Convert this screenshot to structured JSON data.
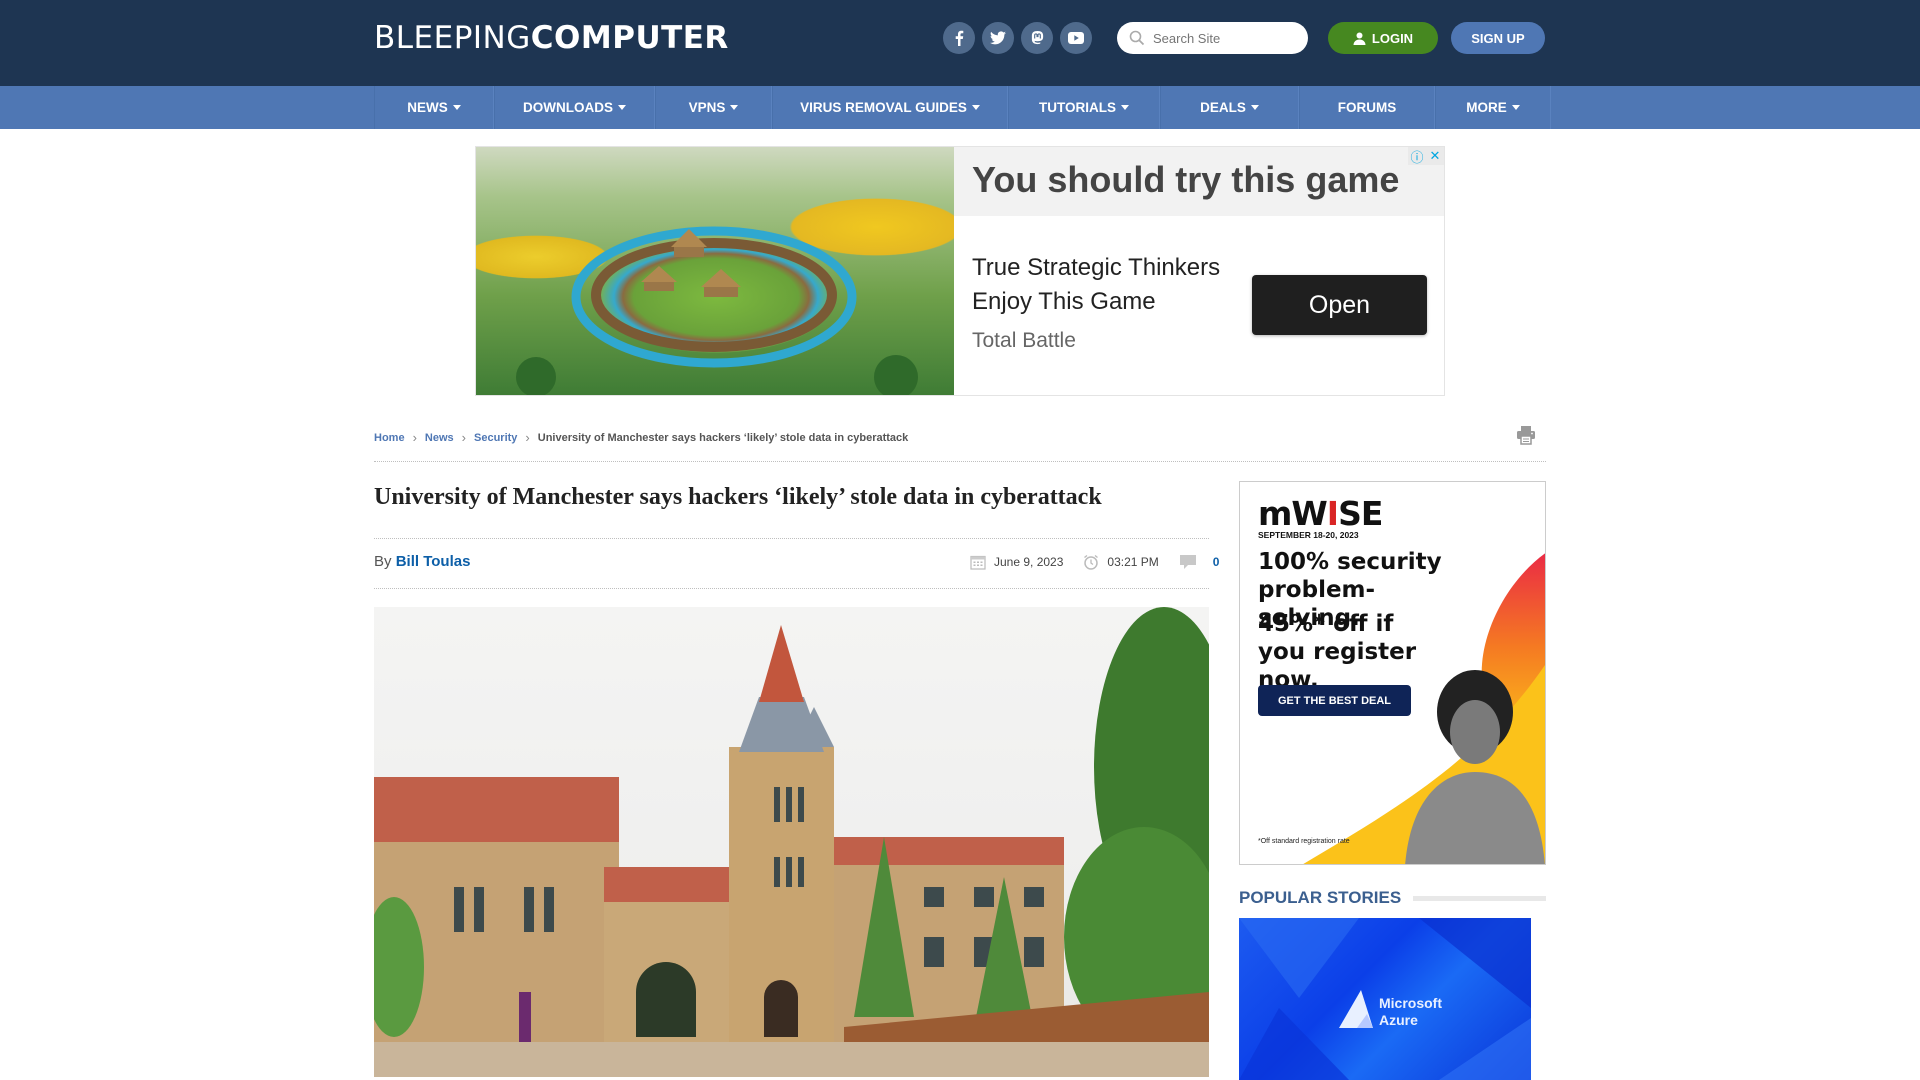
{
  "site": {
    "logo_light": "BLEEPING",
    "logo_bold": "COMPUTER"
  },
  "header": {
    "social": [
      {
        "name": "facebook",
        "icon": "facebook-icon"
      },
      {
        "name": "twitter",
        "icon": "twitter-icon"
      },
      {
        "name": "mastodon",
        "icon": "mastodon-icon"
      },
      {
        "name": "youtube",
        "icon": "youtube-icon"
      }
    ],
    "search_placeholder": "Search Site",
    "search_value": "",
    "login_label": "LOGIN",
    "signup_label": "SIGN UP",
    "colors": {
      "topbar": "#1e3552",
      "navbar": "#4f77b4",
      "login": "#468820",
      "signup": "#4f77b4"
    }
  },
  "nav": {
    "items": [
      {
        "label": "NEWS",
        "dropdown": true
      },
      {
        "label": "DOWNLOADS",
        "dropdown": true
      },
      {
        "label": "VPNS",
        "dropdown": true
      },
      {
        "label": "VIRUS REMOVAL GUIDES",
        "dropdown": true
      },
      {
        "label": "TUTORIALS",
        "dropdown": true
      },
      {
        "label": "DEALS",
        "dropdown": true
      },
      {
        "label": "FORUMS",
        "dropdown": false
      },
      {
        "label": "MORE",
        "dropdown": true
      }
    ]
  },
  "top_ad": {
    "headline": "You should try this game",
    "subtext": "True Strategic Thinkers Enjoy This Game",
    "brand": "Total Battle",
    "cta": "Open",
    "info_icon": "ⓘ",
    "close_icon": "✕"
  },
  "breadcrumb": {
    "items": [
      "Home",
      "News",
      "Security"
    ],
    "current": "University of Manchester says hackers ‘likely’ stole data in cyberattack"
  },
  "article": {
    "title": "University of Manchester says hackers ‘likely’ stole data in cyberattack",
    "by_label": "By",
    "author": "Bill Toulas",
    "date": "June 9, 2023",
    "time": "03:21 PM",
    "comments": "0"
  },
  "side_ad": {
    "logo_a": "mW",
    "logo_b": "I",
    "logo_c": "SE",
    "date": "SEPTEMBER 18-20, 2023",
    "headline": "100% security problem-solving.",
    "offer": "45%* off if you register now.",
    "cta": "GET THE BEST DEAL",
    "note": "*Off standard registration rate"
  },
  "popular": {
    "heading": "POPULAR STORIES",
    "first_story_image_text_1": "Microsoft",
    "first_story_image_text_2": "Azure"
  }
}
